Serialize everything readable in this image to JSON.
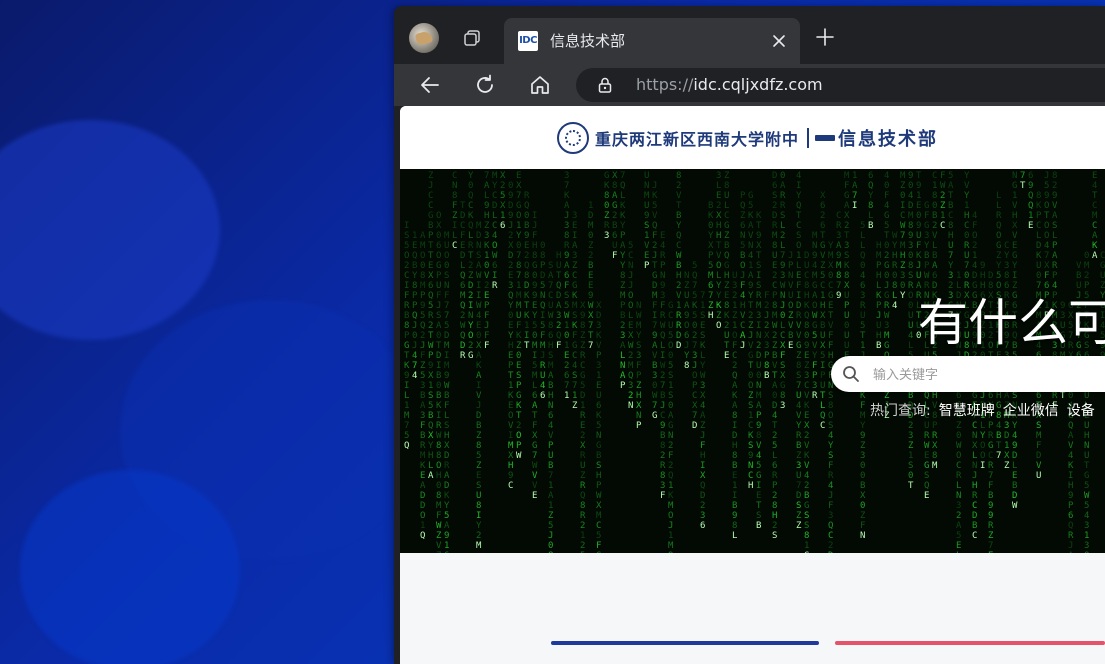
{
  "browser": {
    "tab": {
      "favicon_text": "IDC",
      "title": "信息技术部",
      "close_icon": "close-icon"
    },
    "new_tab_icon": "plus-icon",
    "address": {
      "scheme": "https://",
      "host": "idc.cqljxdfz.com"
    }
  },
  "site": {
    "school_name": "重庆两江新区西南大学附中",
    "dept_name": "信息技术部"
  },
  "hero": {
    "title": "有什么可",
    "search_placeholder": "输入关键字",
    "hot_label": "热门查询:",
    "hot_links": [
      "智慧班牌",
      "企业微信",
      "设备"
    ]
  },
  "colors": {
    "matrix_green": "#2bd633",
    "accent_blue": "#1f3a9c",
    "accent_red": "#e5526a",
    "header_blue": "#1f3a7a"
  }
}
